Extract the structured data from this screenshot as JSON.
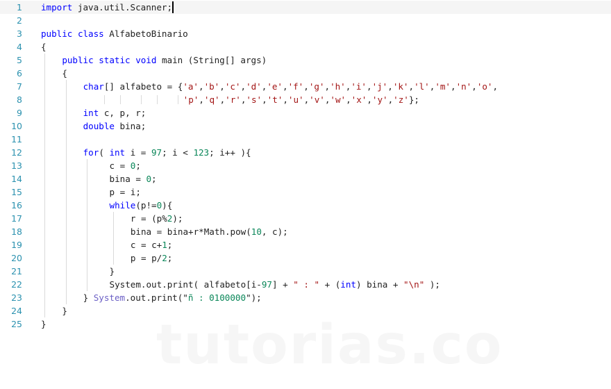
{
  "editor": {
    "language": "java",
    "current_line": 1,
    "watermark": "tutorias.co",
    "colors": {
      "keyword": "#0000ff",
      "string": "#a31515",
      "number": "#098658",
      "class_ref": "#6b5fc5",
      "line_number": "#2b91af",
      "text": "#222222",
      "current_line_bg": "#f5f5f5"
    },
    "lines": [
      {
        "n": "1",
        "indent": 0,
        "tokens": [
          [
            "kw",
            "import"
          ],
          [
            "",
            " java.util.Scanner;"
          ]
        ],
        "cursor": true
      },
      {
        "n": "2",
        "indent": 0,
        "tokens": []
      },
      {
        "n": "3",
        "indent": 0,
        "tokens": [
          [
            "kw",
            "public"
          ],
          [
            "",
            " "
          ],
          [
            "kw",
            "class"
          ],
          [
            "",
            " AlfabetoBinario"
          ]
        ]
      },
      {
        "n": "4",
        "indent": 0,
        "tokens": [
          [
            "",
            "{"
          ]
        ]
      },
      {
        "n": "5",
        "indent": 4,
        "tokens": [
          [
            "kw",
            "public"
          ],
          [
            "",
            " "
          ],
          [
            "kw",
            "static"
          ],
          [
            "",
            " "
          ],
          [
            "kw",
            "void"
          ],
          [
            "",
            " main (String[] args)"
          ]
        ]
      },
      {
        "n": "6",
        "indent": 4,
        "tokens": [
          [
            "",
            "{"
          ]
        ]
      },
      {
        "n": "7",
        "indent": 8,
        "tokens": [
          [
            "kw",
            "char"
          ],
          [
            "",
            "[] alfabeto = {"
          ],
          [
            "str",
            "'a'"
          ],
          [
            "",
            ","
          ],
          [
            "str",
            "'b'"
          ],
          [
            "",
            ","
          ],
          [
            "str",
            "'c'"
          ],
          [
            "",
            ","
          ],
          [
            "str",
            "'d'"
          ],
          [
            "",
            ","
          ],
          [
            "str",
            "'e'"
          ],
          [
            "",
            ","
          ],
          [
            "str",
            "'f'"
          ],
          [
            "",
            ","
          ],
          [
            "str",
            "'g'"
          ],
          [
            "",
            ","
          ],
          [
            "str",
            "'h'"
          ],
          [
            "",
            ","
          ],
          [
            "str",
            "'i'"
          ],
          [
            "",
            ","
          ],
          [
            "str",
            "'j'"
          ],
          [
            "",
            ","
          ],
          [
            "str",
            "'k'"
          ],
          [
            "",
            ","
          ],
          [
            "str",
            "'l'"
          ],
          [
            "",
            ","
          ],
          [
            "str",
            "'m'"
          ],
          [
            "",
            ","
          ],
          [
            "str",
            "'n'"
          ],
          [
            "",
            ","
          ],
          [
            "str",
            "'o'"
          ],
          [
            "",
            ","
          ]
        ]
      },
      {
        "n": "8",
        "indent": 27,
        "tokens": [
          [
            "str",
            "'p'"
          ],
          [
            "",
            ","
          ],
          [
            "str",
            "'q'"
          ],
          [
            "",
            ","
          ],
          [
            "str",
            "'r'"
          ],
          [
            "",
            ","
          ],
          [
            "str",
            "'s'"
          ],
          [
            "",
            ","
          ],
          [
            "str",
            "'t'"
          ],
          [
            "",
            ","
          ],
          [
            "str",
            "'u'"
          ],
          [
            "",
            ","
          ],
          [
            "str",
            "'v'"
          ],
          [
            "",
            ","
          ],
          [
            "str",
            "'w'"
          ],
          [
            "",
            ","
          ],
          [
            "str",
            "'x'"
          ],
          [
            "",
            ","
          ],
          [
            "str",
            "'y'"
          ],
          [
            "",
            ","
          ],
          [
            "str",
            "'z'"
          ],
          [
            "",
            "};"
          ]
        ]
      },
      {
        "n": "9",
        "indent": 8,
        "tokens": [
          [
            "kw",
            "int"
          ],
          [
            "",
            " c, p, r;"
          ]
        ]
      },
      {
        "n": "10",
        "indent": 8,
        "tokens": [
          [
            "kw",
            "double"
          ],
          [
            "",
            " bina;"
          ]
        ]
      },
      {
        "n": "11",
        "indent": 0,
        "tokens": []
      },
      {
        "n": "12",
        "indent": 8,
        "tokens": [
          [
            "kw",
            "for"
          ],
          [
            "",
            "( "
          ],
          [
            "kw",
            "int"
          ],
          [
            "",
            " i = "
          ],
          [
            "num",
            "97"
          ],
          [
            "",
            "; i < "
          ],
          [
            "num",
            "123"
          ],
          [
            "",
            "; i++ ){"
          ]
        ]
      },
      {
        "n": "13",
        "indent": 13,
        "tokens": [
          [
            "",
            "c = "
          ],
          [
            "num",
            "0"
          ],
          [
            "",
            ";"
          ]
        ]
      },
      {
        "n": "14",
        "indent": 13,
        "tokens": [
          [
            "",
            "bina = "
          ],
          [
            "num",
            "0"
          ],
          [
            "",
            ";"
          ]
        ]
      },
      {
        "n": "15",
        "indent": 13,
        "tokens": [
          [
            "",
            "p = i;"
          ]
        ]
      },
      {
        "n": "16",
        "indent": 13,
        "tokens": [
          [
            "kw",
            "while"
          ],
          [
            "",
            "(p!="
          ],
          [
            "num",
            "0"
          ],
          [
            "",
            "){"
          ]
        ]
      },
      {
        "n": "17",
        "indent": 17,
        "tokens": [
          [
            "",
            "r = (p%"
          ],
          [
            "num",
            "2"
          ],
          [
            "",
            ");"
          ]
        ]
      },
      {
        "n": "18",
        "indent": 17,
        "tokens": [
          [
            "",
            "bina = bina+r*Math.pow("
          ],
          [
            "num",
            "10"
          ],
          [
            "",
            ", c);"
          ]
        ]
      },
      {
        "n": "19",
        "indent": 17,
        "tokens": [
          [
            "",
            "c = c+"
          ],
          [
            "num",
            "1"
          ],
          [
            "",
            ";"
          ]
        ]
      },
      {
        "n": "20",
        "indent": 17,
        "tokens": [
          [
            "",
            "p = p/"
          ],
          [
            "num",
            "2"
          ],
          [
            "",
            ";"
          ]
        ]
      },
      {
        "n": "21",
        "indent": 13,
        "tokens": [
          [
            "",
            "}"
          ]
        ]
      },
      {
        "n": "22",
        "indent": 13,
        "tokens": [
          [
            "",
            "System.out.print( alfabeto[i-"
          ],
          [
            "num",
            "97"
          ],
          [
            "",
            "] + "
          ],
          [
            "str",
            "\" : \""
          ],
          [
            "",
            " + ("
          ],
          [
            "kw",
            "int"
          ],
          [
            "",
            ") bina + "
          ],
          [
            "str",
            "\"\\n\""
          ],
          [
            "",
            " );"
          ]
        ]
      },
      {
        "n": "23",
        "indent": 8,
        "tokens": [
          [
            "",
            "} "
          ],
          [
            "cls",
            "System"
          ],
          [
            "",
            ".out.print(\""
          ],
          [
            "num",
            "ñ : 0100000"
          ],
          [
            "",
            "\");"
          ]
        ]
      },
      {
        "n": "24",
        "indent": 4,
        "tokens": [
          [
            "",
            "}"
          ]
        ]
      },
      {
        "n": "25",
        "indent": 0,
        "tokens": [
          [
            "",
            "}"
          ]
        ]
      }
    ]
  }
}
